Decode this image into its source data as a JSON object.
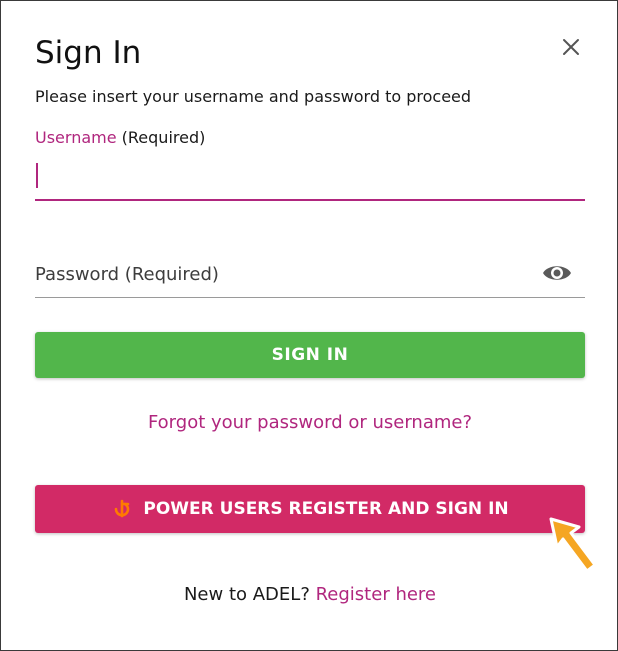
{
  "dialog": {
    "title": "Sign In",
    "subtitle": "Please insert your username and password to proceed",
    "close_icon": "close-icon"
  },
  "username": {
    "label": "Username",
    "required_note": "(Required)",
    "value": ""
  },
  "password": {
    "placeholder": "Password (Required)",
    "toggle_icon": "eye-icon"
  },
  "buttons": {
    "sign_in": "SIGN IN",
    "power_users": "POWER USERS REGISTER AND SIGN IN",
    "power_icon": "power-users-logo-icon"
  },
  "links": {
    "forgot": "Forgot your password or username?",
    "new_prompt": "New to ADEL?",
    "register": "Register here"
  },
  "colors": {
    "accent": "#b0267e",
    "sign_in_bg": "#52b64b",
    "power_bg": "#d22a66",
    "pointer": "#f5a623"
  }
}
